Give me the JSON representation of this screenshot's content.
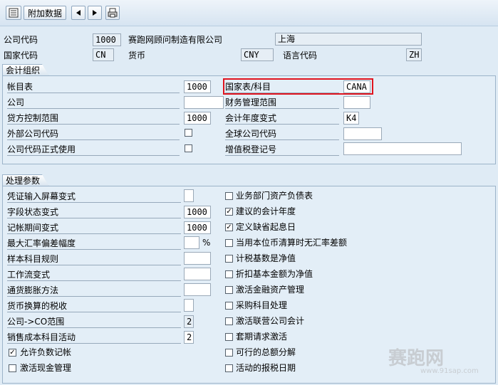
{
  "toolbar": {
    "additional_data_label": "附加数据"
  },
  "header": {
    "company_code_label": "公司代码",
    "company_code": "1000",
    "company_name": "赛跑网顾问制造有限公司",
    "city": "上海",
    "country_key_label": "国家代码",
    "country_key": "CN",
    "currency_label": "货币",
    "currency": "CNY",
    "language_label": "语言代码",
    "language": "ZH"
  },
  "accounting": {
    "title": "会计组织",
    "chart_of_accounts_label": "帐目表",
    "chart_of_accounts": "1000",
    "country_chart_label": "国家表/科目",
    "country_chart": "CANA",
    "company_label": "公司",
    "company": "",
    "fm_area_label": "财务管理范围",
    "fm_area": "",
    "credit_control_label": "贷方控制范围",
    "credit_control": "1000",
    "fiscal_variant_label": "会计年度变式",
    "fiscal_variant": "K4",
    "ext_company_label": "外部公司代码",
    "global_company_label": "全球公司代码",
    "global_company": "",
    "productive_label": "公司代码正式使用",
    "vat_label": "增值税登记号",
    "vat": ""
  },
  "processing": {
    "title": "处理参数",
    "doc_entry_label": "凭证输入屏幕变式",
    "doc_entry": "",
    "field_status_label": "字段状态变式",
    "field_status": "1000",
    "posting_period_label": "记帐期间变式",
    "posting_period": "1000",
    "max_rate_dev_label": "最大汇率偏差幅度",
    "max_rate_dev": "",
    "percent_sign": "%",
    "sample_acct_label": "样本科目规则",
    "sample_acct": "",
    "workflow_label": "工作流变式",
    "workflow": "",
    "inflation_label": "通货膨胀方法",
    "inflation": "",
    "tax_currency_label": "货币换算的税收",
    "tax_currency": "",
    "co_area_label": "公司->CO范围",
    "co_area": "2",
    "cogs_label": "销售成本科目活动",
    "cogs": "2",
    "neg_postings_label": "允许负数记帐",
    "cash_mgmt_label": "激活现金管理",
    "biz_area_label": "业务部门资产负债表",
    "propose_fy_label": "建议的会计年度",
    "default_date_label": "定义缺省起息日",
    "no_fx_diff_label": "当用本位币清算时无汇率差额",
    "tax_net_label": "计税基数是净值",
    "discount_net_label": "折扣基本金额为净值",
    "fin_assets_label": "激活金融资产管理",
    "purchase_acct_label": "采购科目处理",
    "jv_label": "激活联营公司会计",
    "enable_reversal_label": "套期请求激活",
    "ledger_split_label": "可行的总额分解",
    "tax_date_label": "活动的报税日期"
  },
  "watermark": {
    "logo": "赛跑网",
    "url": "www.91sap.com"
  }
}
